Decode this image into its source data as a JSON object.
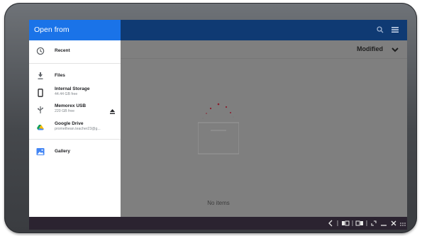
{
  "dialog": {
    "title": "Open from",
    "nav_items": [
      {
        "id": "recent",
        "label": "Recent",
        "icon": "clock-icon"
      },
      {
        "id": "files",
        "label": "Files",
        "icon": "download-icon"
      },
      {
        "id": "internal-storage",
        "label": "Internal Storage",
        "subtitle": "44.44 GB free",
        "icon": "phone-icon"
      },
      {
        "id": "memorex-usb",
        "label": "Memorex USB",
        "subtitle": "220 GB free",
        "icon": "usb-icon"
      },
      {
        "id": "google-drive",
        "label": "Google Drive",
        "subtitle": "promethean.teacher23@g...",
        "icon": "google-drive-icon"
      },
      {
        "id": "gallery",
        "label": "Gallery",
        "icon": "gallery-icon"
      }
    ]
  },
  "toolbar": {
    "search_icon": "search-icon",
    "view_icon": "list-view-icon"
  },
  "sort": {
    "label": "Modified",
    "icon": "chevron-down-icon"
  },
  "content": {
    "empty_message": "No items"
  },
  "shelf": {
    "controls": [
      "back-icon",
      "split-window-icon",
      "maximize-icon",
      "minimize-icon",
      "close-icon",
      "grid-icon"
    ]
  },
  "colors": {
    "drawer_header": "#1a73e8",
    "top_bar": "#0f3a73",
    "scrim": "#7f7f7f",
    "shelf": "#2b2330"
  }
}
